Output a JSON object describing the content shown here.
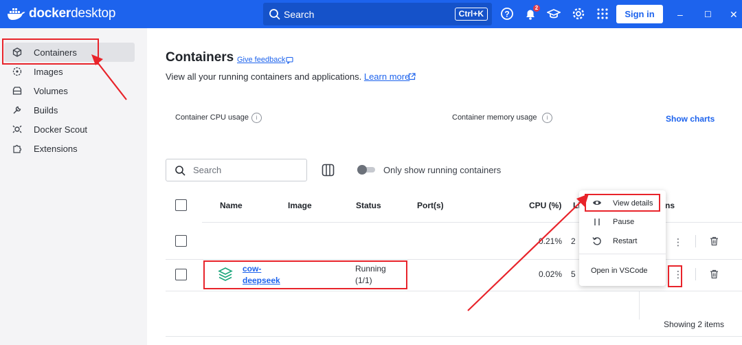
{
  "app": {
    "brand_bold": "docker",
    "brand_light": "desktop"
  },
  "topbar": {
    "search_label": "Search",
    "shortcut": "Ctrl+K",
    "notification_count": "2",
    "sign_in": "Sign in",
    "window_controls": [
      "–",
      "☐",
      "✕"
    ]
  },
  "sidebar": {
    "items": [
      {
        "label": "Containers",
        "icon": "cube-icon",
        "active": true
      },
      {
        "label": "Images",
        "icon": "images-icon"
      },
      {
        "label": "Volumes",
        "icon": "volumes-icon"
      },
      {
        "label": "Builds",
        "icon": "wrench-icon"
      },
      {
        "label": "Docker Scout",
        "icon": "scout-icon"
      },
      {
        "label": "Extensions",
        "icon": "puzzle-icon"
      }
    ]
  },
  "main": {
    "title": "Containers",
    "feedback": "Give feedback",
    "subtitle": "View all your running containers and applications.",
    "learn_more": "Learn more",
    "cpu_usage_label": "Container CPU usage",
    "memory_usage_label": "Container memory usage",
    "show_charts": "Show charts",
    "search_placeholder": "Search",
    "toggle_label": "Only show running containers",
    "columns": [
      "Name",
      "Image",
      "Status",
      "Port(s)",
      "CPU (%)",
      "Li",
      "ns"
    ],
    "rows": [
      {
        "name": "",
        "status": "",
        "cpu": "0.21%",
        "last": "2"
      },
      {
        "name_line1": "cow-",
        "name_line2": "deepseek",
        "status_line1": "Running",
        "status_line2": "(1/1)",
        "cpu": "0.02%",
        "last": "5"
      }
    ],
    "footer": "Showing 2 items"
  },
  "context_menu": {
    "items": [
      "View details",
      "Pause",
      "Restart",
      "Open in VSCode"
    ]
  },
  "colors": {
    "brand": "#1d63ed",
    "annotation": "#e8232a"
  }
}
